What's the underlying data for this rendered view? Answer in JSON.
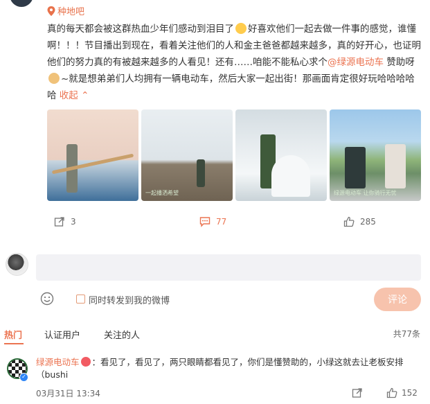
{
  "post": {
    "topic": "种地吧",
    "text_part1": "真的每天都会被这群热血少年们感动到泪目了",
    "text_part2": "好喜欢他们一起去做一件事的感觉，谁懂啊！！！节目播出到现在，看着关注他们的人和金主爸爸都越来越多，真的好开心，也证明他们的努力真的有被越来越多的人看见！还有……咱能不能私心求个",
    "mention": "@绿源电动车",
    "text_part3": "赞助呀",
    "text_part4": "~就是想弟弟们人均拥有一辆电动车，然后大家一起出街！那画面肯定很好玩哈哈哈哈哈",
    "collapse_label": "收起",
    "photo_captions": [
      "",
      "一起播洒希望",
      "",
      "绿源电动车 让你骑行无忧"
    ]
  },
  "actions": {
    "share_count": "3",
    "comment_count": "77",
    "like_count": "285"
  },
  "composer": {
    "placeholder": "",
    "repost_label": "同时转发到我的微博",
    "submit_label": "评论"
  },
  "comments_tabs": {
    "tabs": [
      "热门",
      "认证用户",
      "关注的人"
    ],
    "total": "共77条"
  },
  "comment": {
    "user": "绿源电动车",
    "text": "：看见了，看见了，两只眼睛都看见了，你们是懂赞助的，小绿这就去让老板安排（bushi",
    "time": "03月31日 13:34",
    "like_count": "152"
  },
  "colors": {
    "accent": "#eb7350",
    "submit_bg": "#f7c3ad",
    "input_bg": "#f2f2f5"
  }
}
